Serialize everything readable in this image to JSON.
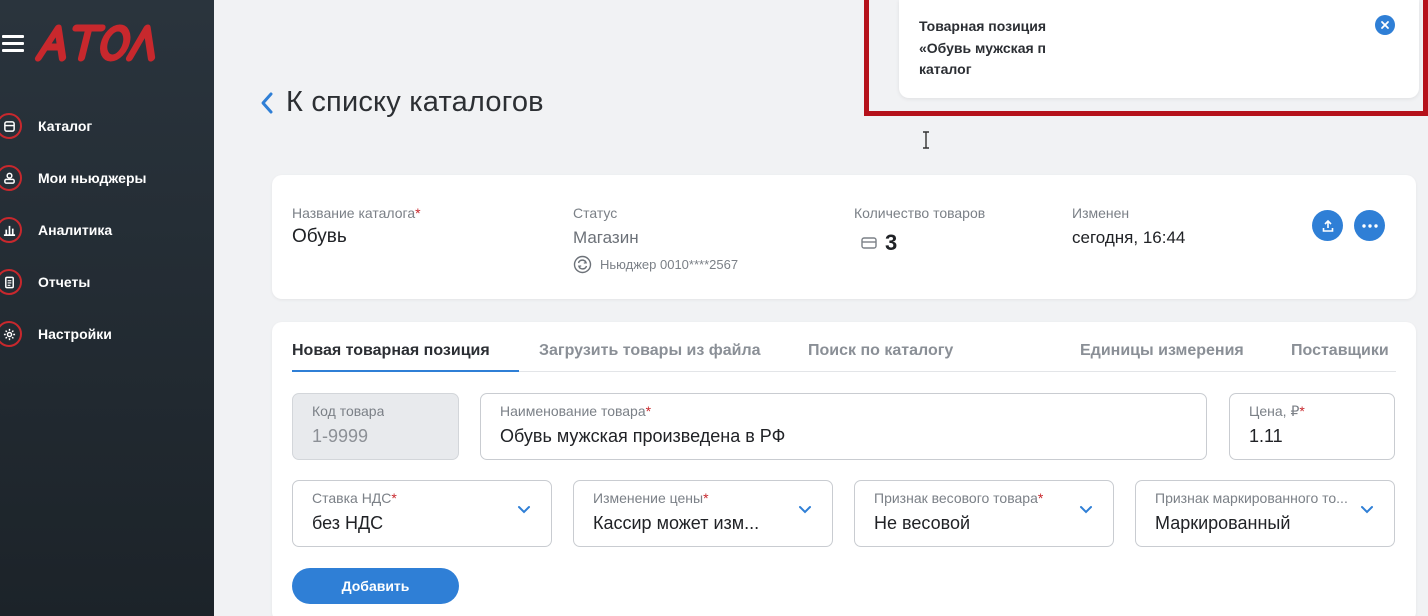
{
  "brand": {
    "logo_text": "АТОЛ",
    "color": "#c8282d"
  },
  "sidebar": {
    "items": [
      {
        "label": "Каталог",
        "icon": "catalog-icon"
      },
      {
        "label": "Мои ньюджеры",
        "icon": "user-device-icon"
      },
      {
        "label": "Аналитика",
        "icon": "bar-chart-icon"
      },
      {
        "label": "Отчеты",
        "icon": "document-icon"
      },
      {
        "label": "Настройки",
        "icon": "gear-icon"
      }
    ]
  },
  "page": {
    "back_title": "К списку каталогов"
  },
  "summary": {
    "name_label": "Название каталога",
    "name_required": "*",
    "name_value": "Обувь",
    "status_label": "Статус",
    "status_value": "Магазин",
    "device_text": "Ньюджер 0010****2567",
    "count_label": "Количество товаров",
    "count_value": "3",
    "changed_label": "Изменен",
    "changed_value": "сегодня, 16:44"
  },
  "tabs": [
    {
      "label": "Новая товарная позиция",
      "active": true
    },
    {
      "label": "Загрузить товары из файла",
      "active": false
    },
    {
      "label": "Поиск по каталогу",
      "active": false
    },
    {
      "label": "Единицы измерения",
      "active": false
    },
    {
      "label": "Поставщики",
      "active": false
    }
  ],
  "form": {
    "code": {
      "label": "Код товара",
      "value": "1-9999"
    },
    "name": {
      "label": "Наименование товара",
      "required": "*",
      "value": "Обувь мужская произведена в РФ"
    },
    "price": {
      "label": "Цена, ₽",
      "required": "*",
      "value": "1.11"
    },
    "vat": {
      "label": "Ставка НДС",
      "required": "*",
      "value": "без НДС"
    },
    "price_change": {
      "label": "Изменение цены",
      "required": "*",
      "value": "Кассир может изм..."
    },
    "weight": {
      "label": "Признак весового товара",
      "required": "*",
      "value": "Не весовой"
    },
    "marked": {
      "label": "Признак маркированного то...",
      "value": "Маркированный"
    },
    "add_button": "Добавить"
  },
  "toast": {
    "lines": [
      "Товарная позиция",
      "«Обувь мужская п",
      "каталог"
    ]
  },
  "colors": {
    "accent": "#2f7fd6",
    "sidebar": "#2a343d",
    "highlight": "#b5121b"
  }
}
